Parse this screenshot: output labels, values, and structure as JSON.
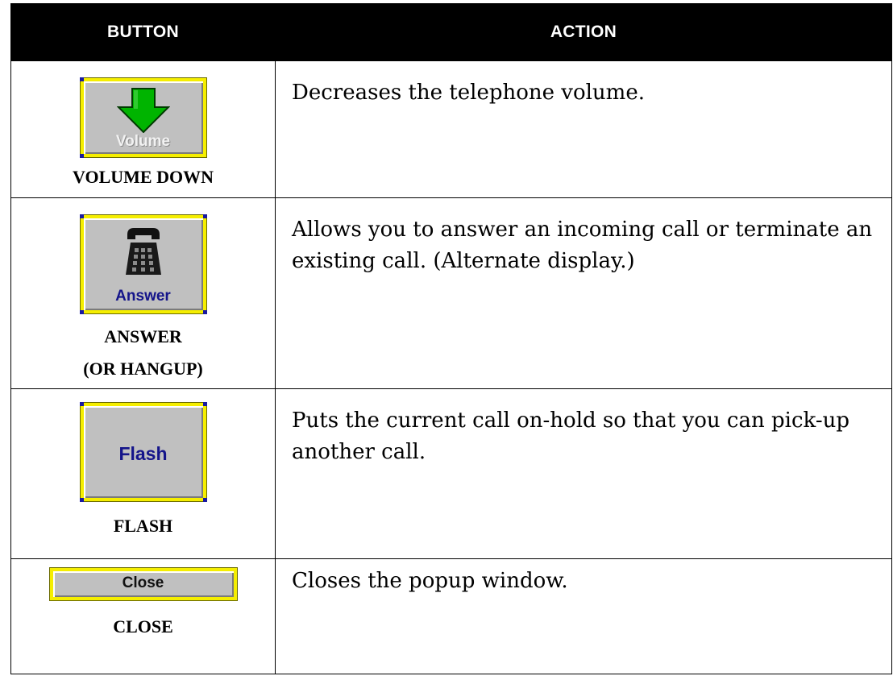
{
  "header": {
    "button_col": "BUTTON",
    "action_col": "ACTION"
  },
  "rows": [
    {
      "button_text": "Volume",
      "label_lines": [
        "VOLUME DOWN"
      ],
      "action": "Decreases the telephone volume."
    },
    {
      "button_text": "Answer",
      "label_lines": [
        "ANSWER",
        "(OR HANGUP)"
      ],
      "action": "Allows you to answer an incoming call or terminate an existing call. (Alternate display.)"
    },
    {
      "button_text": "Flash",
      "label_lines": [
        "FLASH"
      ],
      "action": "Puts the current call on-hold so that you can pick-up another call."
    },
    {
      "button_text": "Close",
      "label_lines": [
        "CLOSE"
      ],
      "action": "Closes the popup window."
    }
  ],
  "colors": {
    "button_face": "#c0c0c0",
    "button_frame": "#f5ee00",
    "button_corner": "#1a1aa0",
    "arrow_green": "#00b400",
    "text_navy": "#14148a"
  },
  "icons": {
    "volume": "arrow-down-icon",
    "answer": "telephone-icon"
  }
}
